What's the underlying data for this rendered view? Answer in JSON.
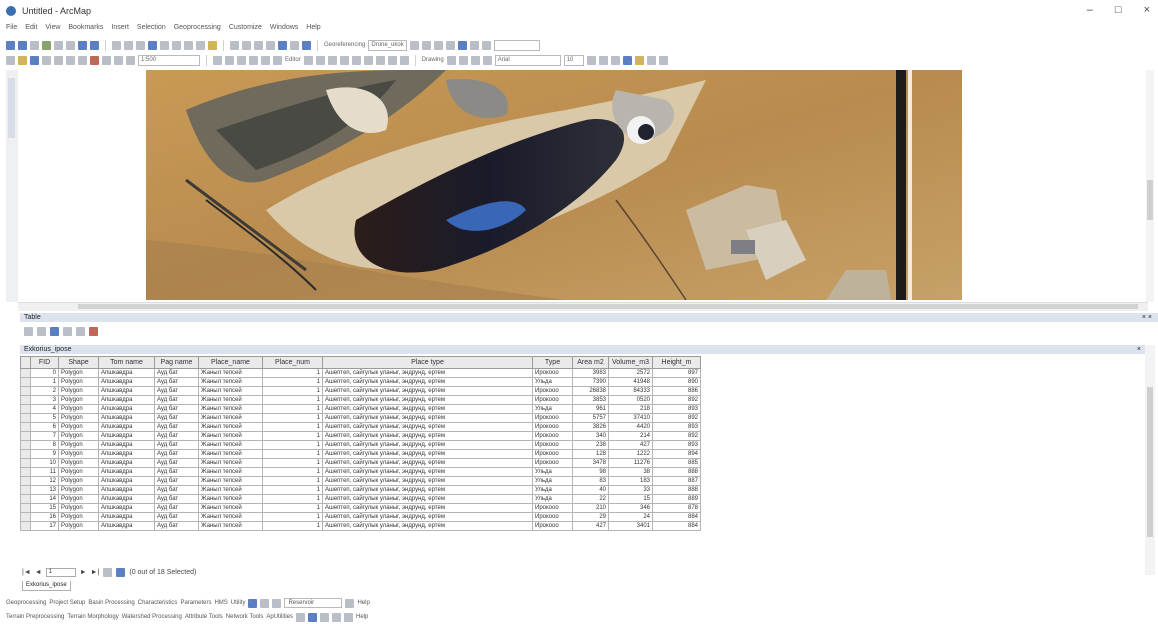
{
  "window": {
    "title": "Untitled - ArcMap",
    "controls": {
      "minimize": "–",
      "maximize": "□",
      "close": "×"
    }
  },
  "menu": [
    "File",
    "Edit",
    "View",
    "Bookmarks",
    "Insert",
    "Selection",
    "Geoprocessing",
    "Customize",
    "Windows",
    "Help"
  ],
  "toolbar": {
    "scale_value": "1:500",
    "georeferencing_label": "Georeferencing",
    "georeferencing_layer": "Drone_ukok",
    "editor_label": "Editor",
    "drawing_label": "Drawing",
    "font_name": "Arial",
    "font_size": "10"
  },
  "table": {
    "window_title": "Table",
    "tab_title": "Exkorius_ipose",
    "columns": [
      "FID",
      "Shape",
      "Tom name",
      "Pag name",
      "Place_name",
      "Place_num",
      "Place type",
      "Type",
      "Area m2",
      "Volume_m3",
      "Height_m"
    ],
    "rows": [
      [
        "0",
        "Polygon",
        "Апшкавдра",
        "Ауд бат",
        "Жаныл тепсей",
        "1",
        "Ашептеп, сайгулык уланыг, эндрунд, ертем",
        "Ирокооо",
        "3983",
        "2572",
        "897"
      ],
      [
        "1",
        "Polygon",
        "Апшкавдра",
        "Ауд бат",
        "Жаныл тепсей",
        "1",
        "Ашептеп, сайгулык уланыг, эндрунд, ертем",
        "Ульда",
        "7390",
        "41948",
        "890"
      ],
      [
        "2",
        "Polygon",
        "Апшкавдра",
        "Ауд бат",
        "Жаныл тепсей",
        "1",
        "Ашептеп, сайгулык уланыг, эндрунд, ертем",
        "Ирокооо",
        "26838",
        "84333",
        "886"
      ],
      [
        "3",
        "Polygon",
        "Апшкавдра",
        "Ауд бат",
        "Жаныл тепсей",
        "1",
        "Ашептеп, сайгулык уланыг, эндрунд, ертем",
        "Ирокооо",
        "3853",
        "0520",
        "892"
      ],
      [
        "4",
        "Polygon",
        "Апшкавдра",
        "Ауд бат",
        "Жаныл тепсей",
        "1",
        "Ашептеп, сайгулык уланыг, эндрунд, ертем",
        "Ульда",
        "961",
        "218",
        "893"
      ],
      [
        "5",
        "Polygon",
        "Апшкавдра",
        "Ауд бат",
        "Жаныл тепсей",
        "1",
        "Ашептеп, сайгулык уланыг, эндрунд, ертем",
        "Ирокооо",
        "5757",
        "37410",
        "892"
      ],
      [
        "6",
        "Polygon",
        "Апшкавдра",
        "Ауд бат",
        "Жаныл тепсей",
        "1",
        "Ашептеп, сайгулык уланыг, эндрунд, ертем",
        "Ирокооо",
        "3826",
        "4420",
        "893"
      ],
      [
        "7",
        "Polygon",
        "Апшкавдра",
        "Ауд бат",
        "Жаныл тепсей",
        "1",
        "Ашептеп, сайгулык уланыг, эндрунд, ертем",
        "Ирокооо",
        "340",
        "214",
        "892"
      ],
      [
        "8",
        "Polygon",
        "Апшкавдра",
        "Ауд бат",
        "Жаныл тепсей",
        "1",
        "Ашептеп, сайгулык уланыг, эндрунд, ертем",
        "Ирокооо",
        "238",
        "427",
        "893"
      ],
      [
        "9",
        "Polygon",
        "Апшкавдра",
        "Ауд бат",
        "Жаныл тепсей",
        "1",
        "Ашептеп, сайгулык уланыг, эндрунд, ертем",
        "Ирокооо",
        "128",
        "1222",
        "894"
      ],
      [
        "10",
        "Polygon",
        "Апшкавдра",
        "Ауд бат",
        "Жаныл тепсей",
        "1",
        "Ашептеп, сайгулык уланыг, эндрунд, ертем",
        "Ирокооо",
        "3478",
        "11276",
        "885"
      ],
      [
        "11",
        "Polygon",
        "Апшкавдра",
        "Ауд бат",
        "Жаныл тепсей",
        "1",
        "Ашептеп, сайгулык уланыг, эндрунд, ертем",
        "Ульда",
        "98",
        "38",
        "888"
      ],
      [
        "12",
        "Polygon",
        "Апшкавдра",
        "Ауд бат",
        "Жаныл тепсей",
        "1",
        "Ашептеп, сайгулык уланыг, эндрунд, ертем",
        "Ульда",
        "83",
        "183",
        "887"
      ],
      [
        "13",
        "Polygon",
        "Апшкавдра",
        "Ауд бат",
        "Жаныл тепсей",
        "1",
        "Ашептеп, сайгулык уланыг, эндрунд, ертем",
        "Ульда",
        "40",
        "33",
        "888"
      ],
      [
        "14",
        "Polygon",
        "Апшкавдра",
        "Ауд бат",
        "Жаныл тепсей",
        "1",
        "Ашептеп, сайгулык уланыг, эндрунд, ертем",
        "Ульда",
        "22",
        "15",
        "889"
      ],
      [
        "15",
        "Polygon",
        "Апшкавдра",
        "Ауд бат",
        "Жаныл тепсей",
        "1",
        "Ашептеп, сайгулык уланыг, эндрунд, ертем",
        "Ирокооо",
        "210",
        "346",
        "878"
      ],
      [
        "16",
        "Polygon",
        "Апшкавдра",
        "Ауд бат",
        "Жаныл тепсей",
        "1",
        "Ашептеп, сайгулык уланыг, эндрунд, ертем",
        "Ирокооо",
        "29",
        "24",
        "884"
      ],
      [
        "17",
        "Polygon",
        "Апшкавдра",
        "Ауд бат",
        "Жаныл тепсей",
        "1",
        "Ашептеп, сайгулык уланыг, эндрунд, ертем",
        "Ирокооо",
        "427",
        "3401",
        "884"
      ]
    ],
    "nav": {
      "first": "|◄",
      "prev": "◄",
      "record": "1",
      "next": "►",
      "last": "►|",
      "status": "(0 out of 18 Selected)"
    },
    "sheet_tab": "Exkorius_ipose"
  },
  "bottom_toolbars": {
    "row1": [
      "Geoprocessing",
      "Project Setup",
      "Basin Processing",
      "Characteristics",
      "Parameters",
      "HMS",
      "Utility"
    ],
    "row1_box": "Reservoir",
    "row1_help": "Help",
    "row2": [
      "Terrain Preprocessing",
      "Terrain Morphology",
      "Watershed Processing",
      "Attribute Tools",
      "Network Tools",
      "ApUtilities"
    ],
    "row2_help": "Help"
  }
}
